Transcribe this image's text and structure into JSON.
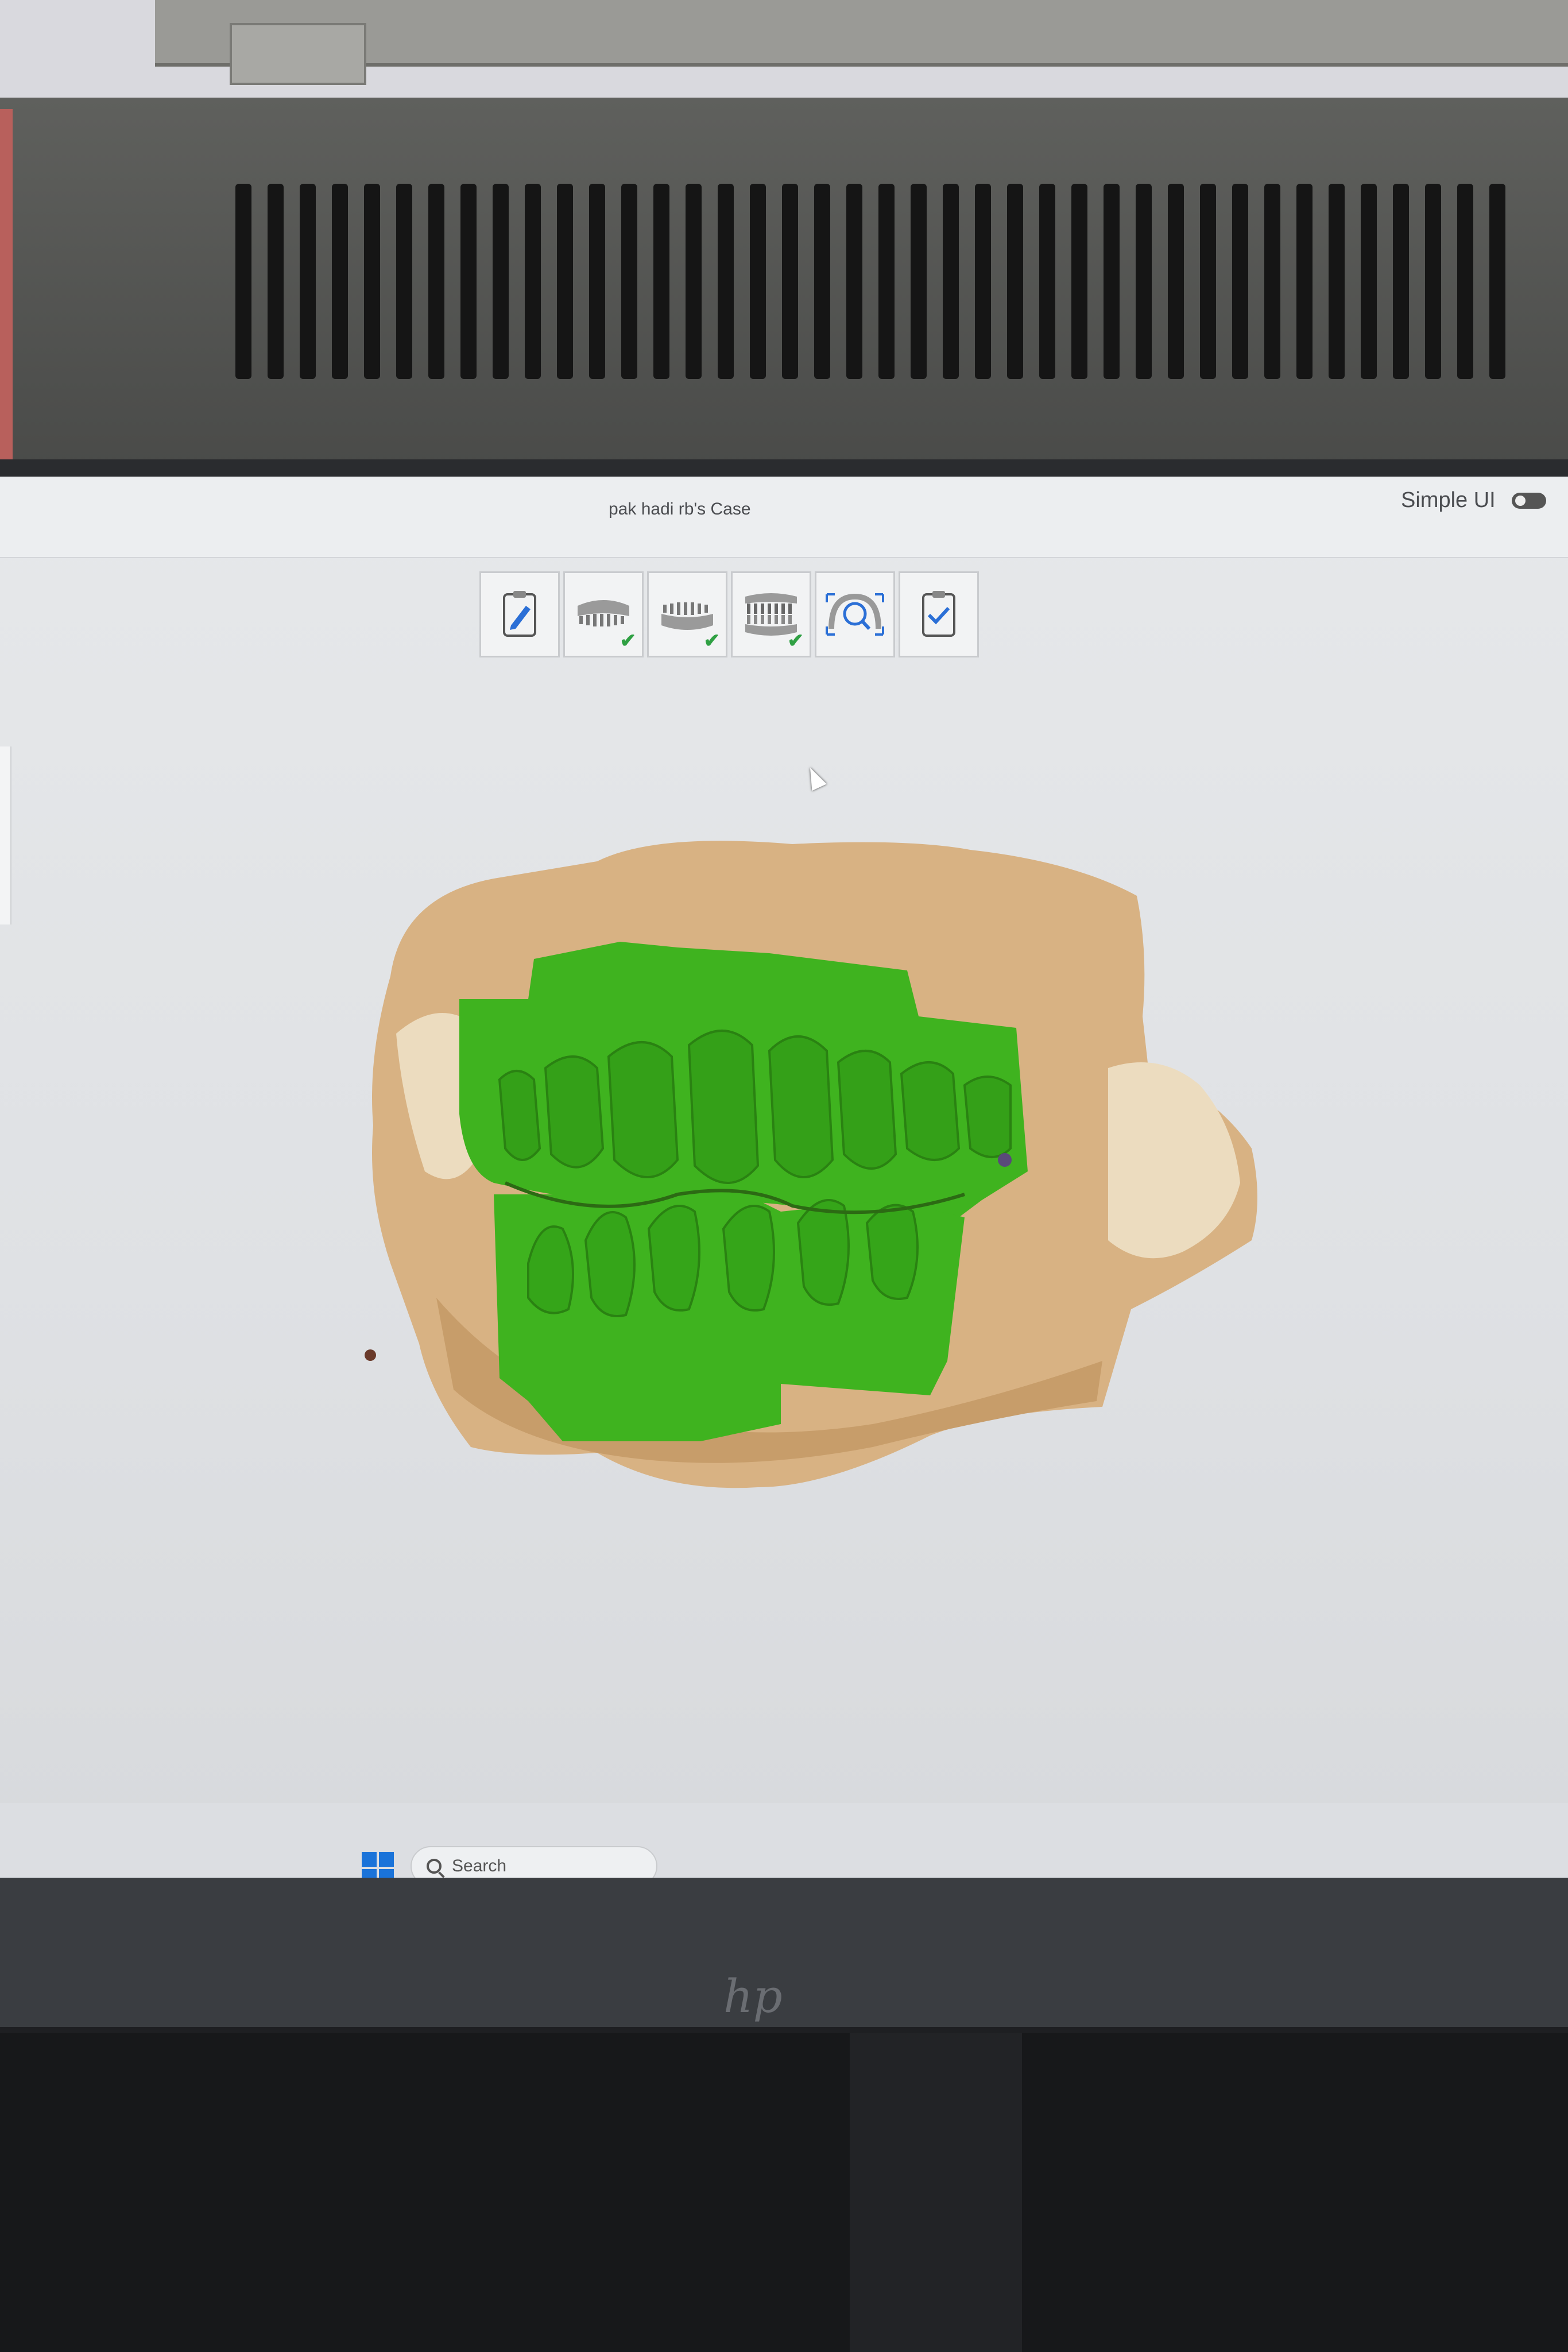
{
  "window": {
    "title": "pak hadi rb's Case"
  },
  "header": {
    "simple_ui_label": "Simple UI",
    "simple_ui_enabled": false
  },
  "workflow_steps": [
    {
      "icon": "clipboard-edit-icon",
      "completed": false
    },
    {
      "icon": "upper-jaw-icon",
      "completed": true
    },
    {
      "icon": "lower-jaw-icon",
      "completed": true
    },
    {
      "icon": "bite-icon",
      "completed": true
    },
    {
      "icon": "scan-inspect-icon",
      "completed": false
    },
    {
      "icon": "clipboard-check-icon",
      "completed": false
    }
  ],
  "taskbar": {
    "search_placeholder": "Search"
  },
  "colors": {
    "scan_green": "#3fb31f",
    "model_tan": "#d8b283",
    "accent_blue": "#2b6fd6"
  },
  "monitor_brand": "hp"
}
